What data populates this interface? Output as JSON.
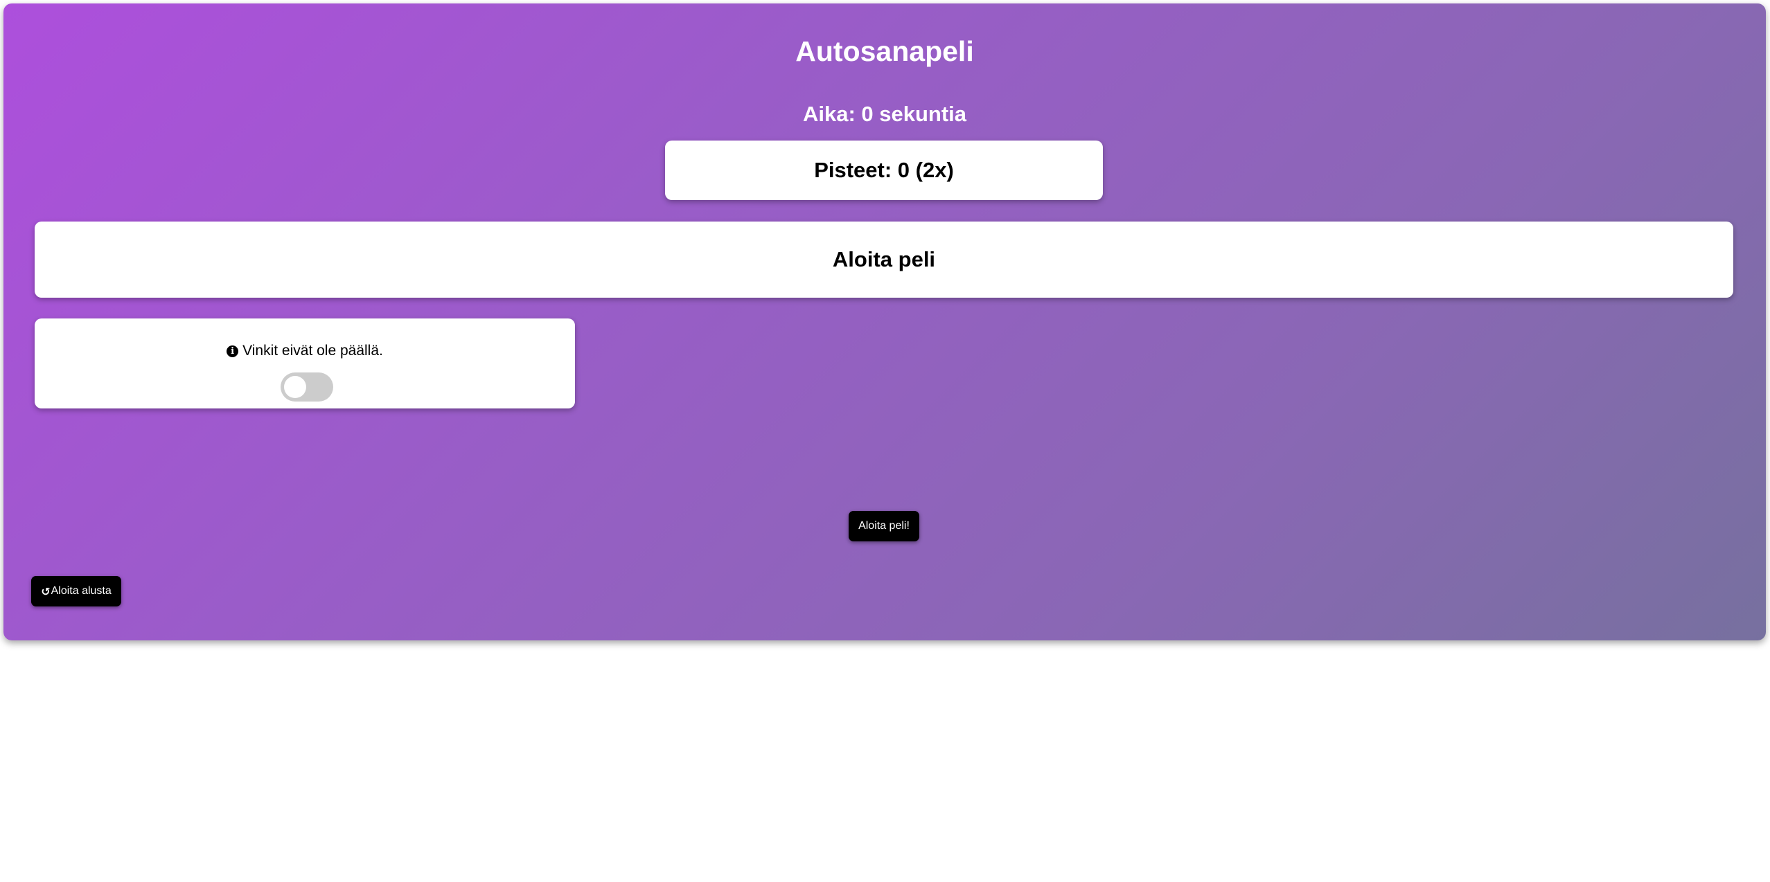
{
  "game": {
    "title": "Autosanapeli",
    "timer": "Aika: 0 sekuntia",
    "score": "Pisteet: 0 (2x)",
    "start_prompt": "Aloita peli",
    "hints": {
      "text": "Vinkit eivät ole päällä.",
      "icon": "info-circle-icon",
      "enabled": false
    },
    "start_button_label": "Aloita peli!",
    "restart_button_label": "Aloita alusta",
    "restart_icon": "undo-icon"
  },
  "colors": {
    "gradient_start": "#ad4fdc",
    "gradient_end": "#77709f",
    "card": "#ffffff",
    "button": "#000000",
    "toggle_off": "#cccccc"
  }
}
